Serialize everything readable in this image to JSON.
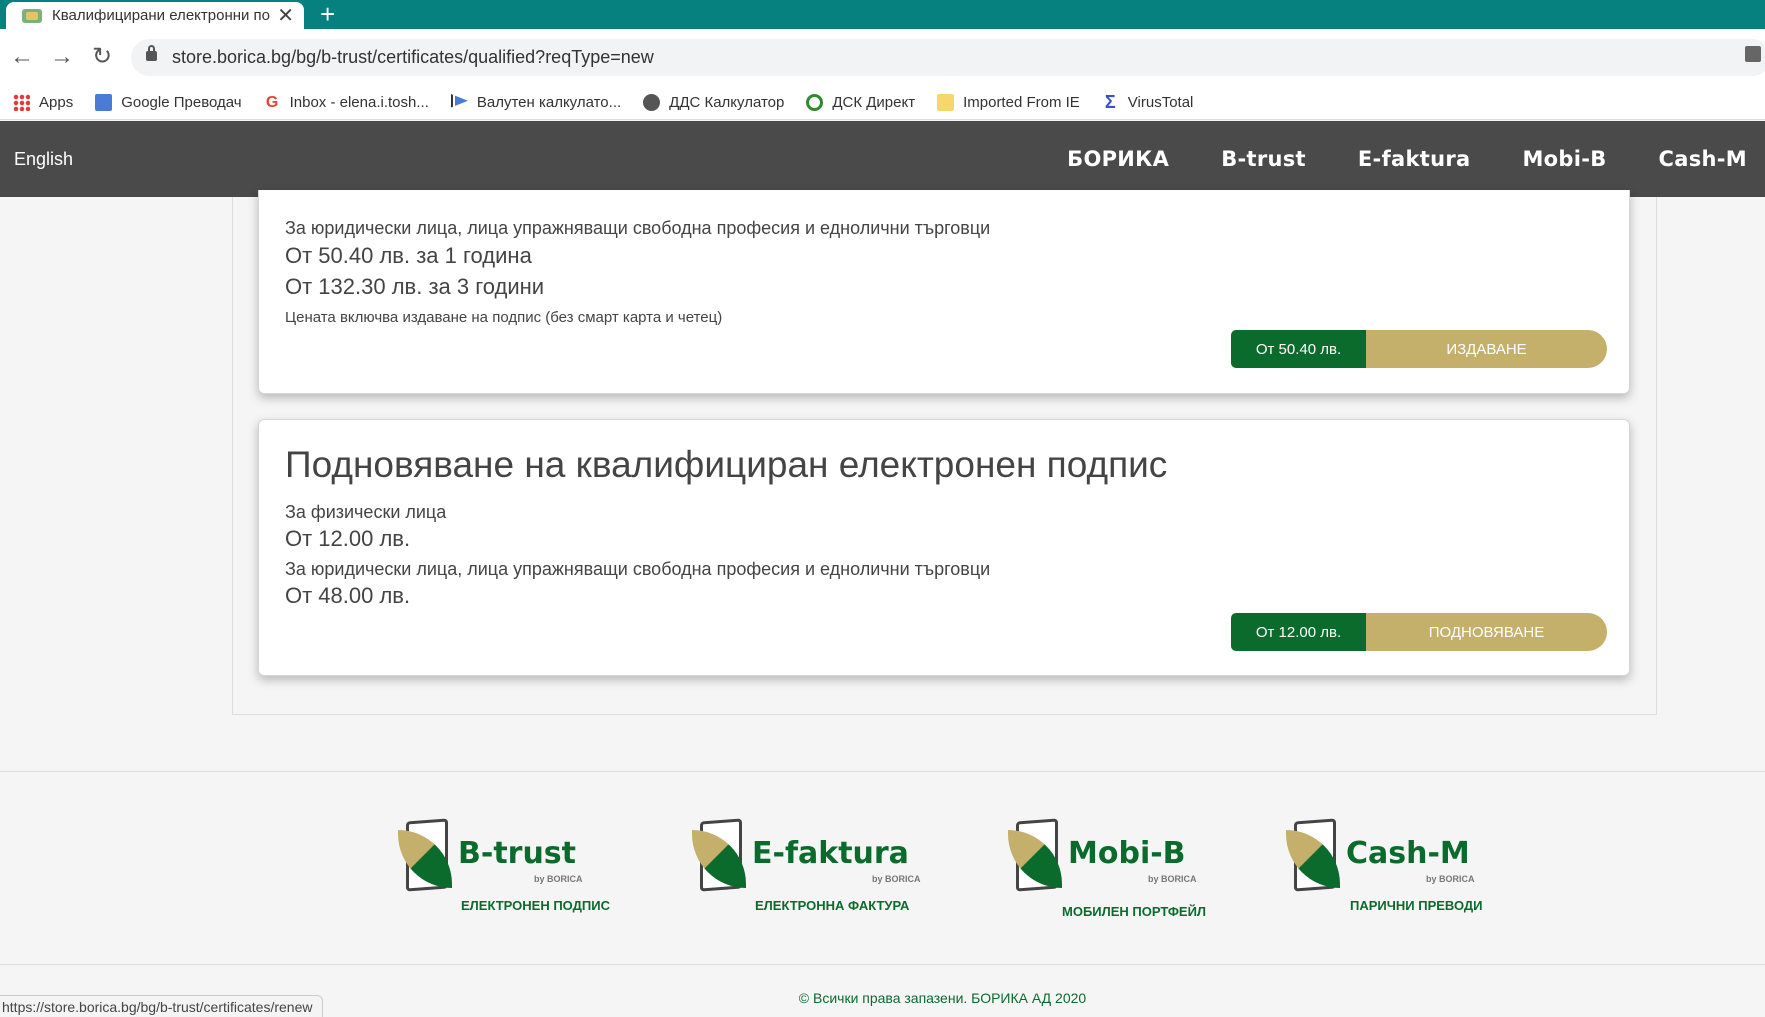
{
  "browser": {
    "tab_title": "Квалифицирани електронни по",
    "new_tab_symbol": "+",
    "close_symbol": "✕",
    "url": "store.borica.bg/bg/b-trust/certificates/qualified?reqType=new",
    "bookmarks": [
      {
        "label": "Apps",
        "icon": "apps-grid-icon"
      },
      {
        "label": "Google Преводач",
        "icon": "google-translate-icon"
      },
      {
        "label": "Inbox - elena.i.tosh...",
        "icon": "google-icon"
      },
      {
        "label": "Валутен калкулато...",
        "icon": "flag-icon"
      },
      {
        "label": "ДДС Калкулатор",
        "icon": "globe-icon"
      },
      {
        "label": "ДСК Директ",
        "icon": "dsk-icon"
      },
      {
        "label": "Imported From IE",
        "icon": "folder-icon"
      },
      {
        "label": "VirusTotal",
        "icon": "sigma-icon"
      }
    ],
    "status_url": "https://store.borica.bg/bg/b-trust/certificates/renew"
  },
  "header": {
    "language_link": "English",
    "nav": [
      "БОРИКА",
      "B-trust",
      "E-faktura",
      "Mobi-B",
      "Cash-M"
    ]
  },
  "card1": {
    "line_legal": "За юридически лица, лица упражняващи свободна професия и еднолични търговци",
    "price_1y": "От 50.40 лв. за 1 година",
    "price_3y": "От 132.30 лв. за 3 години",
    "note": "Цената включва издаване на подпис (без смарт карта и четец)",
    "action_price": "От 50.40 лв.",
    "action_label": "ИЗДАВАНЕ"
  },
  "card2": {
    "title": "Подновяване на квалифициран електронен подпис",
    "line_individuals": "За физически лица",
    "price_individuals": "От 12.00 лв.",
    "line_legal": "За юридически лица, лица упражняващи свободна професия и еднолични търговци",
    "price_legal": "От 48.00 лв.",
    "action_price": "От 12.00 лв.",
    "action_label": "ПОДНОВЯВАНЕ"
  },
  "footer": {
    "products": [
      {
        "name": "B-trust",
        "by": "by BORICA",
        "subtitle": "ЕЛЕКТРОНЕН ПОДПИС"
      },
      {
        "name": "E-faktura",
        "by": "by BORICA",
        "subtitle": "ЕЛЕКТРОННА ФАКТУРА"
      },
      {
        "name": "Mobi-B",
        "by": "by BORICA",
        "subtitle": "МОБИЛЕН ПОРТФЕЙЛ"
      },
      {
        "name": "Cash-M",
        "by": "by BORICA",
        "subtitle": "ПАРИЧНИ ПРЕВОДИ"
      }
    ],
    "copyright": "© Всички права запазени. БОРИКА АД 2020"
  },
  "colors": {
    "tab_strip": "#078080",
    "header_bg": "#4a4a4a",
    "brand_green": "#0b6b2d",
    "brand_gold": "#c4b06a"
  }
}
